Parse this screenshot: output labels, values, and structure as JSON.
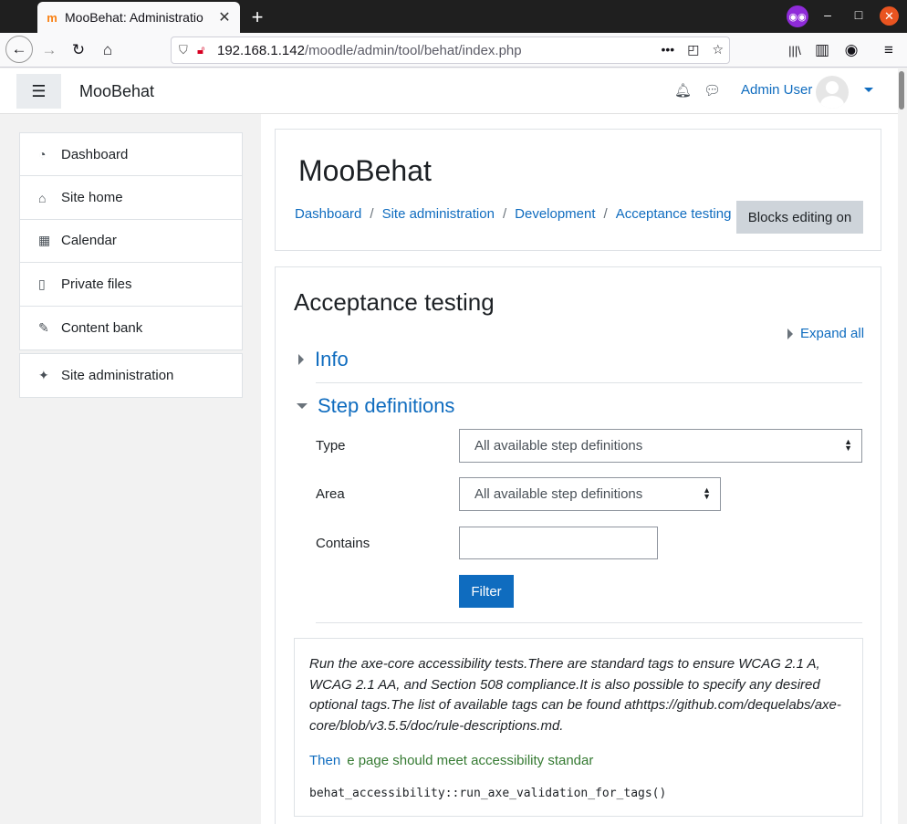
{
  "browser": {
    "tab_title": "MooBehat: Administratio",
    "tab_favicon": "m",
    "new_tab": "+",
    "url_host": "192.168.1.142",
    "url_path": "/moodle/admin/tool/behat/index.php",
    "url_icons": [
      "•••",
      "◰",
      "☆"
    ],
    "toolbar_icons": [
      "|||\\",
      "▥",
      "◉",
      "≡"
    ]
  },
  "header": {
    "menu_icon": "☰",
    "site_name": "MooBehat",
    "user_name": "Admin User"
  },
  "nav": {
    "items": [
      {
        "label": "Dashboard",
        "icon": "tachometer-icon",
        "glyph": "◔"
      },
      {
        "label": "Site home",
        "icon": "home-icon",
        "glyph": "⌂"
      },
      {
        "label": "Calendar",
        "icon": "calendar-icon",
        "glyph": "▦"
      },
      {
        "label": "Private files",
        "icon": "file-icon",
        "glyph": "▯"
      },
      {
        "label": "Content bank",
        "icon": "paintbrush-icon",
        "glyph": "✎"
      }
    ],
    "admin": {
      "label": "Site administration",
      "icon": "wrench-icon",
      "glyph": "✦"
    }
  },
  "page": {
    "heading": "MooBehat",
    "breadcrumbs": [
      "Dashboard",
      "Site administration",
      "Development",
      "Acceptance testing"
    ],
    "breadcrumb_sep": "/",
    "editing_button": "Blocks editing on"
  },
  "content": {
    "title": "Acceptance testing",
    "expand_all": "Expand all",
    "section_info": "Info",
    "section_steps": "Step definitions",
    "form": {
      "type_label": "Type",
      "type_value": "All available step definitions",
      "area_label": "Area",
      "area_value": "All available step definitions",
      "contains_label": "Contains",
      "contains_value": "",
      "filter_button": "Filter"
    },
    "step": {
      "description": "Run the axe-core accessibility tests.There are standard tags to ensure WCAG 2.1 A, WCAG 2.1 AA, and Section 508 compliance.It is also possible to specify any desired optional tags.The list of available tags can be found athttps://github.com/dequelabs/axe-core/blob/v3.5.5/doc/rule-descriptions.md.",
      "keyword": "Then",
      "text": "e page should meet accessibility standar",
      "code": "behat_accessibility::run_axe_validation_for_tags()"
    }
  },
  "colors": {
    "link": "#0f6cbf",
    "step_text": "#357a32",
    "primary_button": "#0f6cbf"
  }
}
